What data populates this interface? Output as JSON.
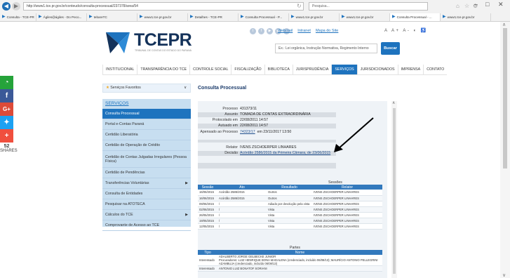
{
  "browser": {
    "url": "http://www1.tce.pr.gov.br/conteudo/consulta-processual/237378/area/54",
    "search_placeholder": "Pesquisa...",
    "tabs": [
      {
        "label": "Consulta - TCE-PR"
      },
      {
        "label": "Ágiles@ágiles - Do Peco..."
      },
      {
        "label": "tebareTC"
      },
      {
        "label": "www1.tce.pr.gov.br"
      },
      {
        "label": "Detalhes - TCE-PR"
      },
      {
        "label": "Consulta Processual - P..."
      },
      {
        "label": "www1.tce.pr.gov.br"
      },
      {
        "label": "www1.tce.pr.gov.br"
      },
      {
        "label": "Consulta Processual - ...",
        "active": true
      },
      {
        "label": "www1.tce.pr.gov.br"
      }
    ]
  },
  "social": {
    "count": "52",
    "label": "SHARES"
  },
  "header": {
    "logo": "TCEPR",
    "tagline": "TRIBUNAL DE CONTAS DO ESTADO DO PARANÁ",
    "links": [
      "Webmail",
      "Intranet",
      "Mapa do Site"
    ],
    "font_controls": "A A+ A- ◐ ♿",
    "search_placeholder": "Ex.: Lei orgânica, Instrução Normativa, Regimento Interno",
    "search_button": "Buscar"
  },
  "nav": [
    "Institucional",
    "Transparência do TCE",
    "Controle Social",
    "Fiscalização",
    "Biblioteca",
    "Jurisprudência",
    "Serviços",
    "Jurisdicionados",
    "Imprensa",
    "Contato"
  ],
  "nav_active": "Serviços",
  "favorites": {
    "label": "Serviços Favoritos"
  },
  "sidebar": {
    "title": "SERVIÇOS",
    "items": [
      {
        "label": "Consulta Processual",
        "selected": true
      },
      {
        "label": "Portal e-Contas Paraná"
      },
      {
        "label": "Certidão Liberatória"
      },
      {
        "label": "Certidão de Operação de Crédito"
      },
      {
        "label": "Certidão de Contas Julgadas Irregulares (Pessoa Física)",
        "tall": true
      },
      {
        "label": "Certidão de Pendências"
      },
      {
        "label": "Transferências Voluntárias",
        "arrow": true
      },
      {
        "label": "Consulta de Entidades"
      },
      {
        "label": "Pesquisar na ATOTECA"
      },
      {
        "label": "Cálculos do TCE",
        "arrow": true
      },
      {
        "label": "Comprovante de Acesso ao TCE"
      }
    ]
  },
  "content": {
    "title": "Consulta Processual",
    "processo_label": "Processo",
    "processo": "431373/11",
    "assunto_label": "Assunto",
    "assunto": "TOMADA DE CONTAS EXTRAORDINÁRIA",
    "protocolado_label": "Protocolado em",
    "protocolado": "22/08/2011 14:57",
    "autuado_label": "Autuado em",
    "autuado": "22/08/2011 14:57",
    "apensado_label": "Apensado ao Processo",
    "apensado_link": "74323/17",
    "apensado_rest": "em 23/11/2017 13:50",
    "relator_label": "Relator",
    "relator": "IVENS ZSCHOERPER LINHARES",
    "decisao_label": "Decisão",
    "decisao": "Acórdão 2586/2015 da Primeira Câmara, de 23/06/2015"
  },
  "sessoes": {
    "caption": "Sessões",
    "headers": [
      "Sessão",
      "Ato",
      "Resultado",
      "Relator"
    ],
    "rows": [
      [
        "16/06/2015",
        "Acórdão 2586/2015",
        "Outros",
        "IVENS ZSCHOERPER LINHARES"
      ],
      [
        "16/06/2015",
        "Acórdão 2586/2015",
        "Outros",
        "IVENS ZSCHOERPER LINHARES"
      ],
      [
        "09/06/2015",
        "/",
        "Adiado por devolução pela vista",
        "IVENS ZSCHOERPER LINHARES"
      ],
      [
        "02/06/2015",
        "/",
        "Vista",
        "IVENS ZSCHOERPER LINHARES"
      ],
      [
        "26/05/2015",
        "/",
        "Vista",
        "IVENS ZSCHOERPER LINHARES"
      ],
      [
        "19/05/2015",
        "/",
        "Vista",
        "IVENS ZSCHOERPER LINHARES"
      ],
      [
        "12/05/2015",
        "/",
        "Vista",
        "IVENS ZSCHOERPER LINHARES"
      ]
    ]
  },
  "partes": {
    "caption": "Partes",
    "headers": [
      "Tipo",
      "Nome"
    ],
    "rows": [
      [
        "Interessado",
        "ADALBERTO JORGE GELBECKE JUNIOR\nProcuradores: LUIZ HENRIQUE BONA MADALENA (credenciado, incluído 06/08/13); MAURÍCIO ANTONIO PELLEGRINI AZAMBUJA (credenciado, incluído 06/08/13)"
      ],
      [
        "Interessado",
        "ANTONIO LUIZ BONATOF SORIANI"
      ]
    ]
  }
}
